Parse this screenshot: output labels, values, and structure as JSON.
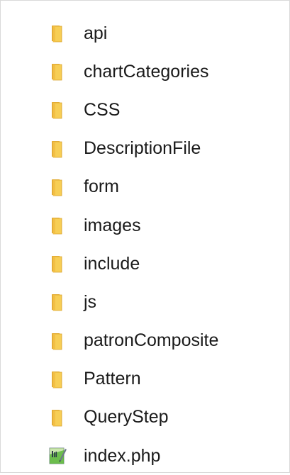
{
  "explorer": {
    "items": [
      {
        "label": "api",
        "type": "folder",
        "icon": "folder-icon"
      },
      {
        "label": "chartCategories",
        "type": "folder",
        "icon": "folder-icon"
      },
      {
        "label": "CSS",
        "type": "folder",
        "icon": "folder-icon"
      },
      {
        "label": "DescriptionFile",
        "type": "folder",
        "icon": "folder-icon"
      },
      {
        "label": "form",
        "type": "folder",
        "icon": "folder-icon"
      },
      {
        "label": "images",
        "type": "folder",
        "icon": "folder-icon"
      },
      {
        "label": "include",
        "type": "folder",
        "icon": "folder-icon"
      },
      {
        "label": "js",
        "type": "folder",
        "icon": "folder-icon"
      },
      {
        "label": "patronComposite",
        "type": "folder",
        "icon": "folder-icon"
      },
      {
        "label": "Pattern",
        "type": "folder",
        "icon": "folder-icon"
      },
      {
        "label": "QueryStep",
        "type": "folder",
        "icon": "folder-icon"
      },
      {
        "label": "index.php",
        "type": "file",
        "icon": "php-file-icon"
      }
    ]
  },
  "colors": {
    "folder_front": "#f7ce55",
    "folder_back": "#e8b23a",
    "folder_edge": "#d9a12b",
    "text": "#1a1a1a"
  }
}
